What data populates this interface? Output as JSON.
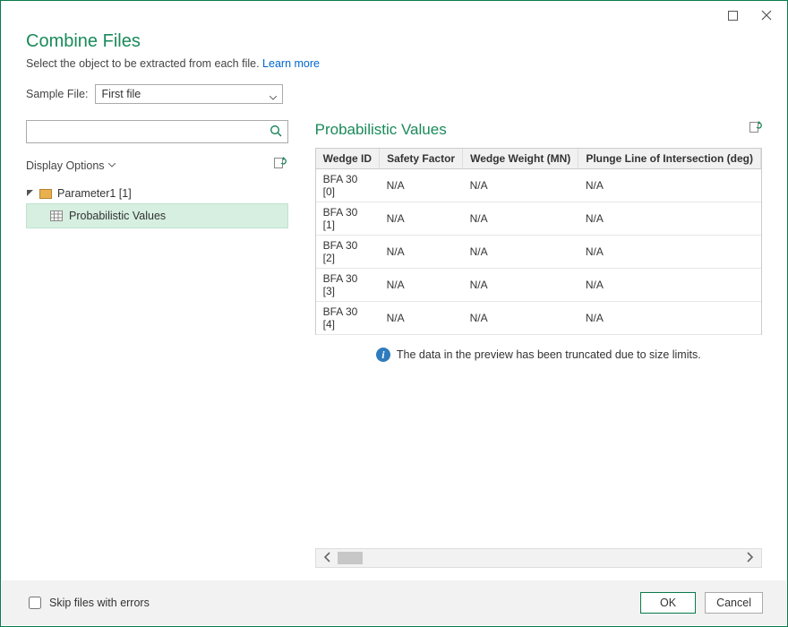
{
  "window": {
    "title": "Combine Files",
    "subtitle_prefix": "Select the object to be extracted from each file. ",
    "learn_more": "Learn more"
  },
  "sample": {
    "label": "Sample File:",
    "value": "First file"
  },
  "search": {
    "placeholder": ""
  },
  "display_options": {
    "label": "Display Options"
  },
  "tree": {
    "parent": "Parameter1 [1]",
    "child": "Probabilistic Values"
  },
  "panel": {
    "title": "Probabilistic Values",
    "columns": [
      "Wedge ID",
      "Safety Factor",
      "Wedge Weight (MN)",
      "Plunge Line of Intersection (deg)"
    ],
    "rows": [
      [
        "BFA 30 [0]",
        "N/A",
        "N/A",
        "N/A"
      ],
      [
        "BFA 30 [1]",
        "N/A",
        "N/A",
        "N/A"
      ],
      [
        "BFA 30 [2]",
        "N/A",
        "N/A",
        "N/A"
      ],
      [
        "BFA 30 [3]",
        "N/A",
        "N/A",
        "N/A"
      ],
      [
        "BFA 30 [4]",
        "N/A",
        "N/A",
        "N/A"
      ]
    ],
    "info": "The data in the preview has been truncated due to size limits."
  },
  "footer": {
    "skip": "Skip files with errors",
    "ok": "OK",
    "cancel": "Cancel"
  }
}
